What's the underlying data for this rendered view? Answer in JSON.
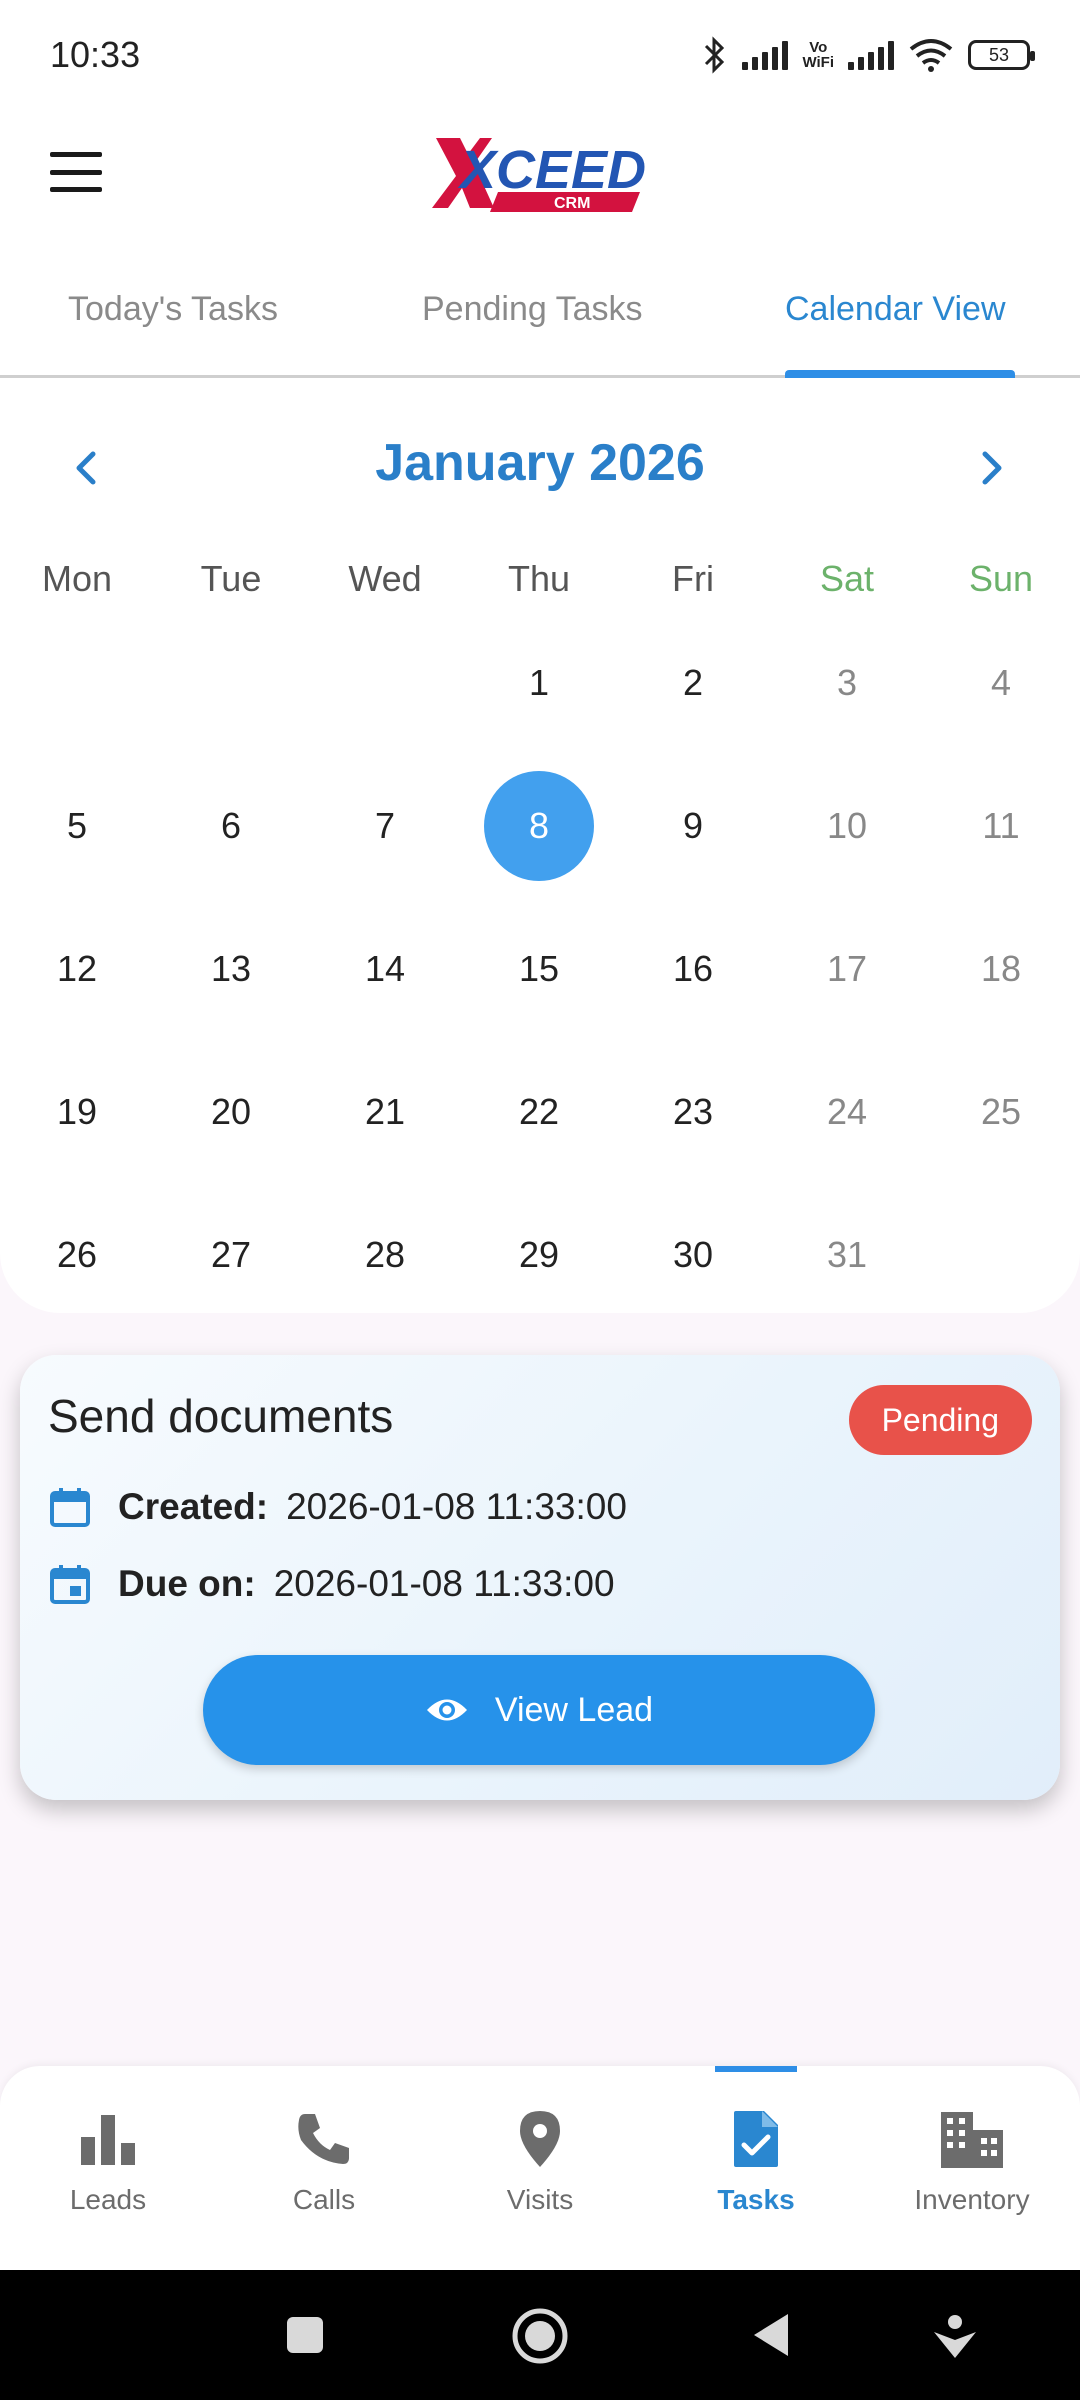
{
  "status_bar": {
    "time": "10:33",
    "vowifi_top": "Vo",
    "vowifi_bottom": "WiFi",
    "battery": "53"
  },
  "app": {
    "logo_text": "XCEED",
    "logo_sub": "CRM"
  },
  "tabs": [
    {
      "label": "Today's Tasks",
      "active": false
    },
    {
      "label": "Pending Tasks",
      "active": false
    },
    {
      "label": "Calendar View",
      "active": true
    }
  ],
  "calendar": {
    "month_label": "January 2026",
    "weekdays": [
      "Mon",
      "Tue",
      "Wed",
      "Thu",
      "Fri",
      "Sat",
      "Sun"
    ],
    "first_weekday_index": 3,
    "days_in_month": 31,
    "selected_day": "8"
  },
  "task": {
    "title": "Send documents",
    "status": "Pending",
    "created_label": "Created:",
    "created_value": "2026-01-08 11:33:00",
    "due_label": "Due on:",
    "due_value": "2026-01-08 11:33:00",
    "button_label": "View Lead"
  },
  "bottom_nav": [
    {
      "label": "Leads",
      "icon": "bar-chart-icon",
      "active": false
    },
    {
      "label": "Calls",
      "icon": "phone-icon",
      "active": false
    },
    {
      "label": "Visits",
      "icon": "location-pin-icon",
      "active": false
    },
    {
      "label": "Tasks",
      "icon": "task-document-icon",
      "active": true
    },
    {
      "label": "Inventory",
      "icon": "building-icon",
      "active": false
    }
  ],
  "colors": {
    "accent": "#2a87d0",
    "selected_day": "#42a0ee",
    "weekend_header": "#6cb26b",
    "badge_pending": "#e8524a",
    "button": "#2692ea"
  }
}
